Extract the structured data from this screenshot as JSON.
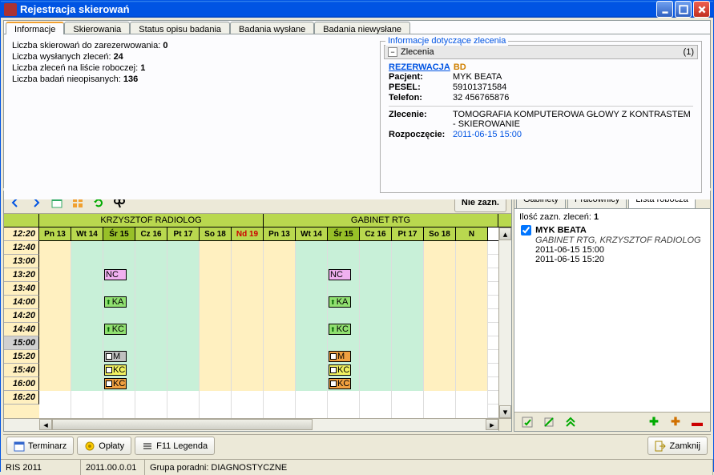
{
  "window": {
    "title": "Rejestracja skierowań"
  },
  "tabs": {
    "info": "Informacje",
    "skier": "Skierowania",
    "status": "Status opisu badania",
    "wysl": "Badania wysłane",
    "niewysl": "Badania niewysłane"
  },
  "info": {
    "l1_pre": "Liczba skierowań do zarezerwowania: ",
    "l1_val": "0",
    "l2_pre": "Liczba wysłanych zleceń: ",
    "l2_val": "24",
    "l3_pre": "Liczba zleceń na liście roboczej: ",
    "l3_val": "1",
    "l4_pre": "Liczba badań nieopisanych: ",
    "l4_val": "136"
  },
  "zlecenie": {
    "fieldset_label": "Informacje dotyczące zlecenia",
    "header_label": "Zlecenia",
    "header_count": "(1)",
    "rez_link": "REZERWACJA",
    "rez_bd": "BD",
    "pacjent_k": "Pacjent:",
    "pacjent_v": "MYK BEATA",
    "pesel_k": "PESEL:",
    "pesel_v": "59101371584",
    "tel_k": "Telefon:",
    "tel_v": "32 456765876",
    "zlec_k": "Zlecenie:",
    "zlec_v": "TOMOGRAFIA KOMPUTEROWA GŁOWY Z KONTRASTEM - SKIEROWANIE",
    "rozp_k": "Rozpoczęcie:",
    "rozp_v": "2011-06-15 15:00"
  },
  "nie_zazn": "Nie zazn.",
  "right": {
    "tabs": {
      "gabinety": "Gabinety",
      "pracownicy": "Pracownicy",
      "lista": "Lista robocza"
    },
    "count_lbl": "Ilość zazn. zleceń: ",
    "count_val": "1",
    "entry": {
      "name": "MYK BEATA",
      "detail": "GABINET RTG, KRZYSZTOF RADIOLOG",
      "t1": "2011-06-15 15:00",
      "t2": "2011-06-15 15:20"
    }
  },
  "schedule": {
    "group1": "KRZYSZTOF RADIOLOG",
    "group2": "GABINET RTG",
    "days1": [
      "Pn 13",
      "Wt 14",
      "Śr 15",
      "Cz 16",
      "Pt 17",
      "So 18",
      "Nd 19"
    ],
    "days2": [
      "Pn 13",
      "Wt 14",
      "Śr 15",
      "Cz 16",
      "Pt 17",
      "So 18",
      "N"
    ],
    "times": [
      "12:20",
      "12:40",
      "13:00",
      "13:20",
      "13:40",
      "14:00",
      "14:20",
      "14:40",
      "15:00",
      "15:20",
      "15:40",
      "16:00",
      "16:20"
    ]
  },
  "bottom": {
    "term": "Terminarz",
    "opl": "Opłaty",
    "leg": "F11 Legenda",
    "close": "Zamknij"
  },
  "status": {
    "s1": "RIS 2011",
    "s2": "2011.00.0.01",
    "s3": "Grupa poradni: DIAGNOSTYCZNE"
  }
}
